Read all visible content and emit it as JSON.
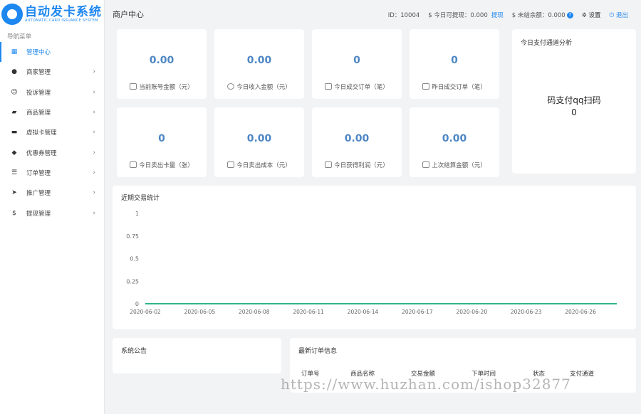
{
  "brand": {
    "name": "自动发卡系统",
    "subtitle": "AUTOMATIC CARD ISSUANCE SYSTEM",
    "color": "#1e87f0"
  },
  "sidebar": {
    "caption": "导航菜单",
    "items": [
      {
        "label": "管理中心",
        "icon": "dashboard-icon",
        "glyph": "▦",
        "active": true,
        "arrow": ""
      },
      {
        "label": "商家管理",
        "icon": "user-icon",
        "glyph": "●",
        "active": false,
        "arrow": "›"
      },
      {
        "label": "投诉管理",
        "icon": "smile-icon",
        "glyph": "☺",
        "active": false,
        "arrow": "›"
      },
      {
        "label": "商品管理",
        "icon": "shopping-bag-icon",
        "glyph": "▰",
        "active": false,
        "arrow": "›"
      },
      {
        "label": "虚拟卡管理",
        "icon": "credit-card-icon",
        "glyph": "▬",
        "active": false,
        "arrow": "›"
      },
      {
        "label": "优惠券管理",
        "icon": "tag-icon",
        "glyph": "◆",
        "active": false,
        "arrow": "›"
      },
      {
        "label": "订单管理",
        "icon": "list-icon",
        "glyph": "☰",
        "active": false,
        "arrow": "›"
      },
      {
        "label": "推广管理",
        "icon": "paper-plane-icon",
        "glyph": "➤",
        "active": false,
        "arrow": "›"
      },
      {
        "label": "提现管理",
        "icon": "dollar-icon",
        "glyph": "$",
        "active": false,
        "arrow": "›"
      }
    ]
  },
  "header": {
    "title": "商户中心",
    "id_text": "ID：10004",
    "withdrawable": "$ 今日可提现：0.000",
    "withdraw_link": "提现",
    "unsettled": "$ 未结余额：0.000",
    "unsettled_help": "?",
    "settings": "设置",
    "logout": "退出"
  },
  "stats": [
    {
      "value": "0.00",
      "label": "当前账号金额（元）"
    },
    {
      "value": "0.00",
      "label": "今日收入金额（元）"
    },
    {
      "value": "0",
      "label": "今日成交订单（笔）"
    },
    {
      "value": "0",
      "label": "昨日成交订单（笔）"
    },
    {
      "value": "0",
      "label": "今日卖出卡量（张）"
    },
    {
      "value": "0.00",
      "label": "今日卖出成本（元）"
    },
    {
      "value": "0.00",
      "label": "今日获得利润（元）"
    },
    {
      "value": "0.00",
      "label": "上次结算金额（元）"
    }
  ],
  "channel": {
    "title": "今日支付通道分析",
    "name": "码支付qq扫码",
    "value": "0"
  },
  "chart_title": "近期交易统计",
  "chart_data": {
    "type": "line",
    "x": [
      "2020-06-02",
      "2020-06-03",
      "2020-06-04",
      "2020-06-05",
      "2020-06-06",
      "2020-06-07",
      "2020-06-08",
      "2020-06-09",
      "2020-06-10",
      "2020-06-11",
      "2020-06-12",
      "2020-06-13",
      "2020-06-14",
      "2020-06-15",
      "2020-06-16",
      "2020-06-17",
      "2020-06-18",
      "2020-06-19",
      "2020-06-20",
      "2020-06-21",
      "2020-06-22",
      "2020-06-23",
      "2020-06-24",
      "2020-06-25",
      "2020-06-26",
      "2020-06-27",
      "2020-06-28"
    ],
    "x_tick_labels": [
      "2020-06-02",
      "2020-06-05",
      "2020-06-08",
      "2020-06-11",
      "2020-06-14",
      "2020-06-17",
      "2020-06-20",
      "2020-06-23",
      "2020-06-26"
    ],
    "series": [
      {
        "values": [
          0,
          0,
          0,
          0,
          0,
          0,
          0,
          0,
          0,
          0,
          0,
          0,
          0,
          0,
          0,
          0,
          0,
          0,
          0,
          0,
          0,
          0,
          0,
          0,
          0,
          0,
          0
        ],
        "color": "#2fb58a"
      }
    ],
    "y_ticks": [
      "0",
      "0.25",
      "0.5",
      "0.75",
      "1"
    ],
    "ylim": [
      0,
      1
    ],
    "title": "",
    "xlabel": "",
    "ylabel": "",
    "grid": false
  },
  "notice": {
    "title": "系统公告"
  },
  "orders": {
    "title": "最新订单信息",
    "columns": [
      "订单号",
      "商品名称",
      "交易金额",
      "下单时间",
      "状态",
      "支付通道"
    ]
  },
  "watermark": "https://www.huzhan.com/ishop32877"
}
